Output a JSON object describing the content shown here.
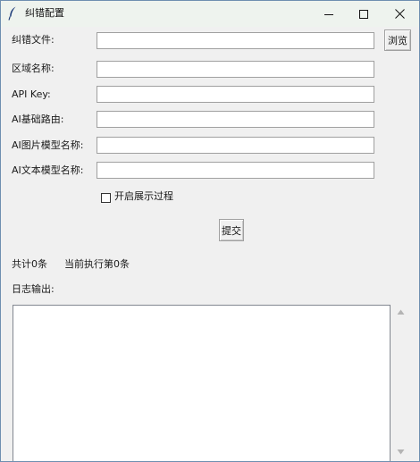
{
  "window": {
    "title": "纠错配置"
  },
  "form": {
    "fields": [
      {
        "label": "纠错文件:",
        "value": ""
      },
      {
        "label": "区域名称:",
        "value": ""
      },
      {
        "label": "API Key:",
        "value": ""
      },
      {
        "label": "AI基础路由:",
        "value": ""
      },
      {
        "label": "AI图片模型名称:",
        "value": ""
      },
      {
        "label": "AI文本模型名称:",
        "value": ""
      }
    ],
    "browse_label": "浏览",
    "show_process_label": "开启展示过程",
    "show_process_checked": false,
    "submit_label": "提交"
  },
  "status": {
    "total_text": "共计0条",
    "current_text": "当前执行第0条"
  },
  "log": {
    "label": "日志输出:",
    "content": ""
  },
  "icons": {
    "app": "feather-icon",
    "minimize": "minimize-icon",
    "maximize": "maximize-icon",
    "close": "close-icon",
    "scroll_up": "triangle-up-icon",
    "scroll_down": "triangle-down-icon"
  }
}
